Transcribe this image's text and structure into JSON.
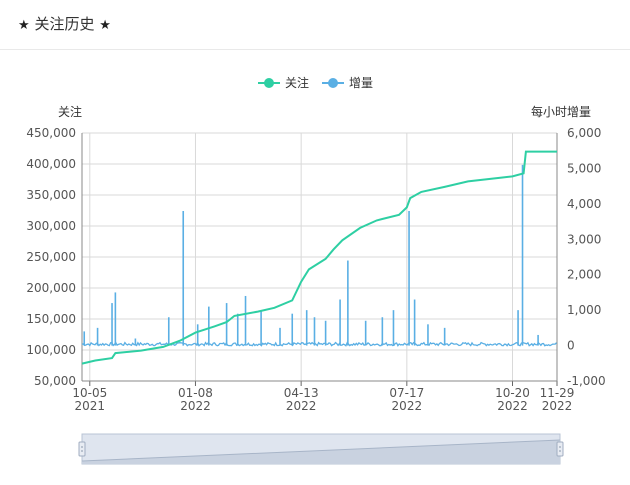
{
  "header": {
    "title": "关注历史",
    "star_left": "★",
    "star_right": "★"
  },
  "chart_data": {
    "type": "line",
    "legend": {
      "placement": "top-center",
      "items": [
        "关注",
        "增量"
      ]
    },
    "colors": {
      "followers": "#2ecfa3",
      "increment": "#5aafe4"
    },
    "y_left": {
      "label": "关注",
      "min": 50000,
      "max": 450000,
      "ticks": [
        "50,000",
        "100,000",
        "150,000",
        "200,000",
        "250,000",
        "300,000",
        "350,000",
        "400,000",
        "450,000"
      ]
    },
    "y_right": {
      "label": "每小时增量",
      "min": -1000,
      "max": 6000,
      "ticks": [
        "-1,000",
        "0",
        "1,000",
        "2,000",
        "3,000",
        "4,000",
        "5,000",
        "6,000"
      ]
    },
    "x_ticks": [
      {
        "date": "2021-10-05",
        "line1": "10-05",
        "line2": "2021"
      },
      {
        "date": "2022-01-08",
        "line1": "01-08",
        "line2": "2022"
      },
      {
        "date": "2022-04-13",
        "line1": "04-13",
        "line2": "2022"
      },
      {
        "date": "2022-07-17",
        "line1": "07-17",
        "line2": "2022"
      },
      {
        "date": "2022-10-20",
        "line1": "10-20",
        "line2": "2022"
      },
      {
        "date": "2022-11-29",
        "line1": "11-29",
        "line2": "2022"
      }
    ],
    "x_range": [
      "2021-09-28",
      "2022-11-29"
    ],
    "grid": true,
    "series": [
      {
        "name": "关注",
        "axis": "left",
        "points": [
          [
            "2021-09-28",
            78000
          ],
          [
            "2021-10-10",
            83000
          ],
          [
            "2021-10-25",
            87000
          ],
          [
            "2021-10-28",
            95000
          ],
          [
            "2021-11-20",
            99000
          ],
          [
            "2021-12-10",
            105000
          ],
          [
            "2021-12-25",
            115000
          ],
          [
            "2022-01-08",
            128000
          ],
          [
            "2022-01-25",
            138000
          ],
          [
            "2022-02-05",
            145000
          ],
          [
            "2022-02-12",
            155000
          ],
          [
            "2022-03-05",
            162000
          ],
          [
            "2022-03-20",
            168000
          ],
          [
            "2022-04-05",
            180000
          ],
          [
            "2022-04-13",
            210000
          ],
          [
            "2022-04-20",
            230000
          ],
          [
            "2022-05-05",
            247000
          ],
          [
            "2022-05-12",
            262000
          ],
          [
            "2022-05-20",
            277000
          ],
          [
            "2022-06-05",
            297000
          ],
          [
            "2022-06-20",
            309000
          ],
          [
            "2022-07-10",
            318000
          ],
          [
            "2022-07-17",
            330000
          ],
          [
            "2022-07-20",
            345000
          ],
          [
            "2022-07-30",
            355000
          ],
          [
            "2022-08-20",
            363000
          ],
          [
            "2022-09-10",
            372000
          ],
          [
            "2022-10-10",
            378000
          ],
          [
            "2022-10-20",
            380000
          ],
          [
            "2022-10-30",
            385000
          ],
          [
            "2022-11-01",
            420000
          ],
          [
            "2022-11-20",
            420000
          ],
          [
            "2022-11-29",
            420000
          ]
        ]
      },
      {
        "name": "增量",
        "axis": "right",
        "baseline": 0,
        "spikes": [
          [
            "2021-09-30",
            400
          ],
          [
            "2021-10-12",
            500
          ],
          [
            "2021-10-25",
            1200
          ],
          [
            "2021-10-28",
            1500
          ],
          [
            "2021-11-15",
            200
          ],
          [
            "2021-12-15",
            800
          ],
          [
            "2021-12-28",
            3800
          ],
          [
            "2022-01-10",
            600
          ],
          [
            "2022-01-20",
            1100
          ],
          [
            "2022-02-05",
            1200
          ],
          [
            "2022-02-15",
            900
          ],
          [
            "2022-02-22",
            1400
          ],
          [
            "2022-03-08",
            1000
          ],
          [
            "2022-03-25",
            500
          ],
          [
            "2022-04-05",
            900
          ],
          [
            "2022-04-18",
            1000
          ],
          [
            "2022-04-25",
            800
          ],
          [
            "2022-05-05",
            700
          ],
          [
            "2022-05-18",
            1300
          ],
          [
            "2022-05-25",
            2400
          ],
          [
            "2022-06-10",
            700
          ],
          [
            "2022-06-25",
            800
          ],
          [
            "2022-07-05",
            1000
          ],
          [
            "2022-07-19",
            3800
          ],
          [
            "2022-07-24",
            1300
          ],
          [
            "2022-08-05",
            600
          ],
          [
            "2022-08-20",
            500
          ],
          [
            "2022-10-25",
            1000
          ],
          [
            "2022-10-29",
            5100
          ],
          [
            "2022-11-12",
            300
          ]
        ]
      }
    ]
  }
}
